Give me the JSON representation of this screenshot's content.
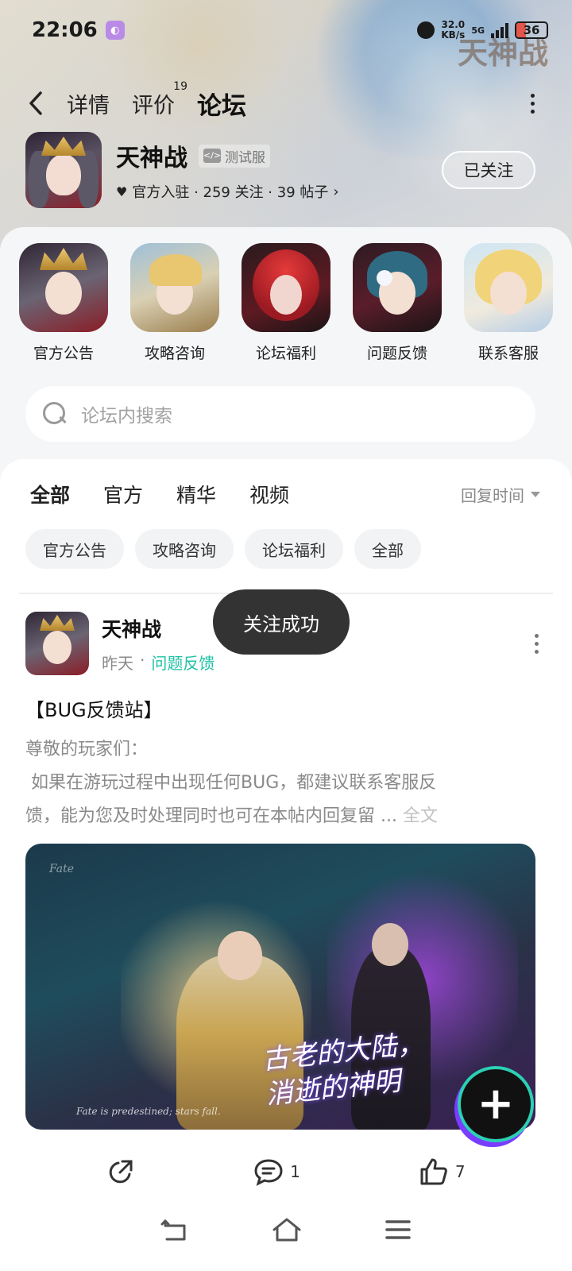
{
  "status_bar": {
    "time": "22:06",
    "net_speed_value": "32.0",
    "net_speed_unit": "KB/s",
    "network": "5G",
    "battery": "36"
  },
  "nav": {
    "tabs": [
      {
        "label": "详情",
        "active": false
      },
      {
        "label": "评价",
        "badge": "19",
        "active": false
      },
      {
        "label": "论坛",
        "active": true
      }
    ]
  },
  "game": {
    "name": "天神战",
    "badge": "测试服",
    "badge_icon": "</>",
    "meta": "官方入驻 · 259 关注 · 39 帖子",
    "follow_button": "已关注",
    "watermark": "天神战"
  },
  "shortcuts": [
    {
      "label": "官方公告"
    },
    {
      "label": "攻略咨询"
    },
    {
      "label": "论坛福利"
    },
    {
      "label": "问题反馈"
    },
    {
      "label": "联系客服"
    }
  ],
  "search": {
    "placeholder": "论坛内搜索"
  },
  "feed_tabs": [
    {
      "label": "全部",
      "active": true
    },
    {
      "label": "官方",
      "active": false
    },
    {
      "label": "精华",
      "active": false
    },
    {
      "label": "视频",
      "active": false
    }
  ],
  "sort_label": "回复时间",
  "chips": [
    "官方公告",
    "攻略咨询",
    "论坛福利",
    "全部"
  ],
  "post": {
    "author": "天神战",
    "time": "昨天",
    "category": "问题反馈",
    "title": "【BUG反馈站】",
    "line1": "尊敬的玩家们：",
    "line2": " 如果在游玩过程中出现任何BUG，都建议联系客服反",
    "line3": "馈，能为您及时处理同时也可在本帖内回复留 ...",
    "full_text_link": " 全文",
    "banner_slogan_1": "古老的大陆，",
    "banner_slogan_2": "消逝的神明",
    "banner_caption": "Fate is predestined; stars fall.",
    "banner_corner": "Fate",
    "comment_count": "1",
    "like_count": "7"
  },
  "toast": "关注成功",
  "colors": {
    "accent": "#2fd6b8",
    "category": "#20c1a6"
  }
}
